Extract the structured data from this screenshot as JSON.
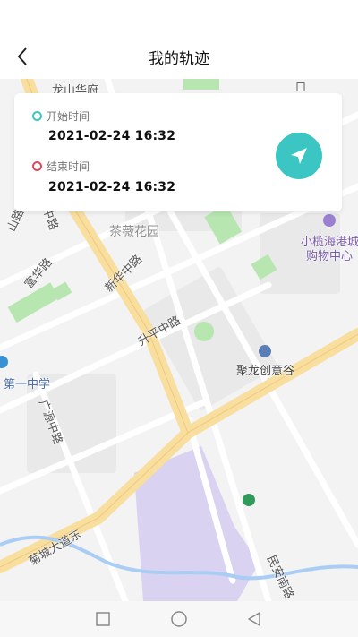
{
  "header": {
    "title": "我的轨迹",
    "back_icon": "chevron-left-icon"
  },
  "time_card": {
    "start": {
      "label": "开始时间",
      "value": "2021-02-24 16:32",
      "color": "#3cc6c3"
    },
    "end": {
      "label": "结束时间",
      "value": "2021-02-24 16:32",
      "color": "#e04a5a"
    },
    "locate_icon": "navigation-arrow-icon",
    "locate_color": "#3cc6c3"
  },
  "map": {
    "labels": {
      "longshan": "龙山华府",
      "chawei": "茶薇花园",
      "xiaolan1": "小榄海港城",
      "xiaolan2": "购物中心",
      "fuhua": "富华路",
      "xinhua": "新华中路",
      "shengping": "升平中路",
      "julong": "聚龙创意谷",
      "yizhong": "第一中学",
      "guangyuan": "广源中路",
      "jucheng": "菊城大道东",
      "minan": "民安南路",
      "shan": "山路",
      "zhong": "中路",
      "mijia": "口"
    },
    "colors": {
      "background": "#f3f3f3",
      "main_road": "#f8dfa0",
      "minor_road": "#ffffff",
      "park": "#b7e6b0",
      "commercial": "#d9d2f0",
      "river": "#a9cdf5"
    }
  },
  "navbar": {
    "square_icon": "recent-apps-icon",
    "circle_icon": "home-icon",
    "triangle_icon": "back-triangle-icon"
  }
}
